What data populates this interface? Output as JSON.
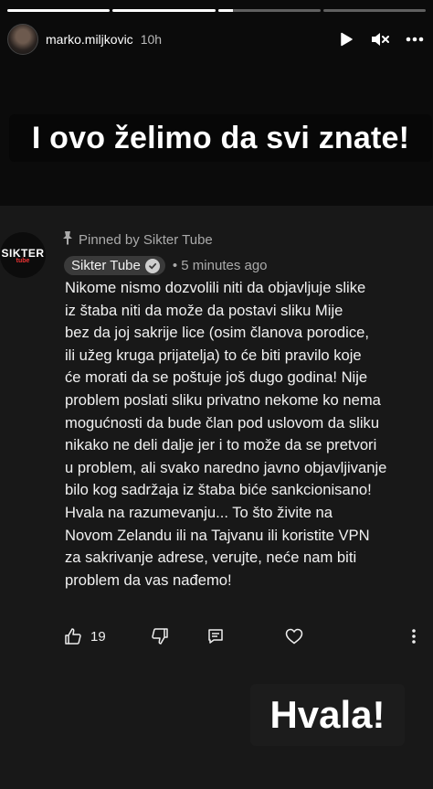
{
  "progress": [
    1,
    1,
    0.15,
    0
  ],
  "header": {
    "username": "marko.miljkovic",
    "time": "10h",
    "play_icon": "play-icon",
    "mute_icon": "mute-icon",
    "more_icon": "more-horizontal-icon"
  },
  "overlay_top": {
    "text": "I ovo želimo da svi znate!"
  },
  "comment": {
    "avatar_logo": "SIKTER",
    "avatar_sub": "tube",
    "pinned_text": "Pinned by Sikter Tube",
    "author": "Sikter Tube",
    "time_ago": "• 5 minutes ago",
    "body": "Nikome nismo dozvolili niti da objavljuje slike\niz štaba niti da može da postavi sliku Mije\nbez da joj sakrije lice (osim članova porodice,\nili užeg kruga prijatelja) to će biti pravilo koje\nće morati da se poštuje još dugo godina! Nije\nproblem poslati sliku privatno nekome ko nema\nmogućnosti da bude član pod uslovom da sliku\nnikako ne deli dalje jer i to može da se pretvori\nu problem, ali svako naredno javno objavljivanje\nbilo kog sadržaja iz štaba biće sankcionisano!\nHvala na razumevanju... To što živite na\nNovom Zelandu ili na Tajvanu ili koristite VPN\nza sakrivanje adrese, verujte, neće nam biti\nproblem da vas nađemo!",
    "likes": "19"
  },
  "overlay_bottom": {
    "text": "Hvala!"
  }
}
